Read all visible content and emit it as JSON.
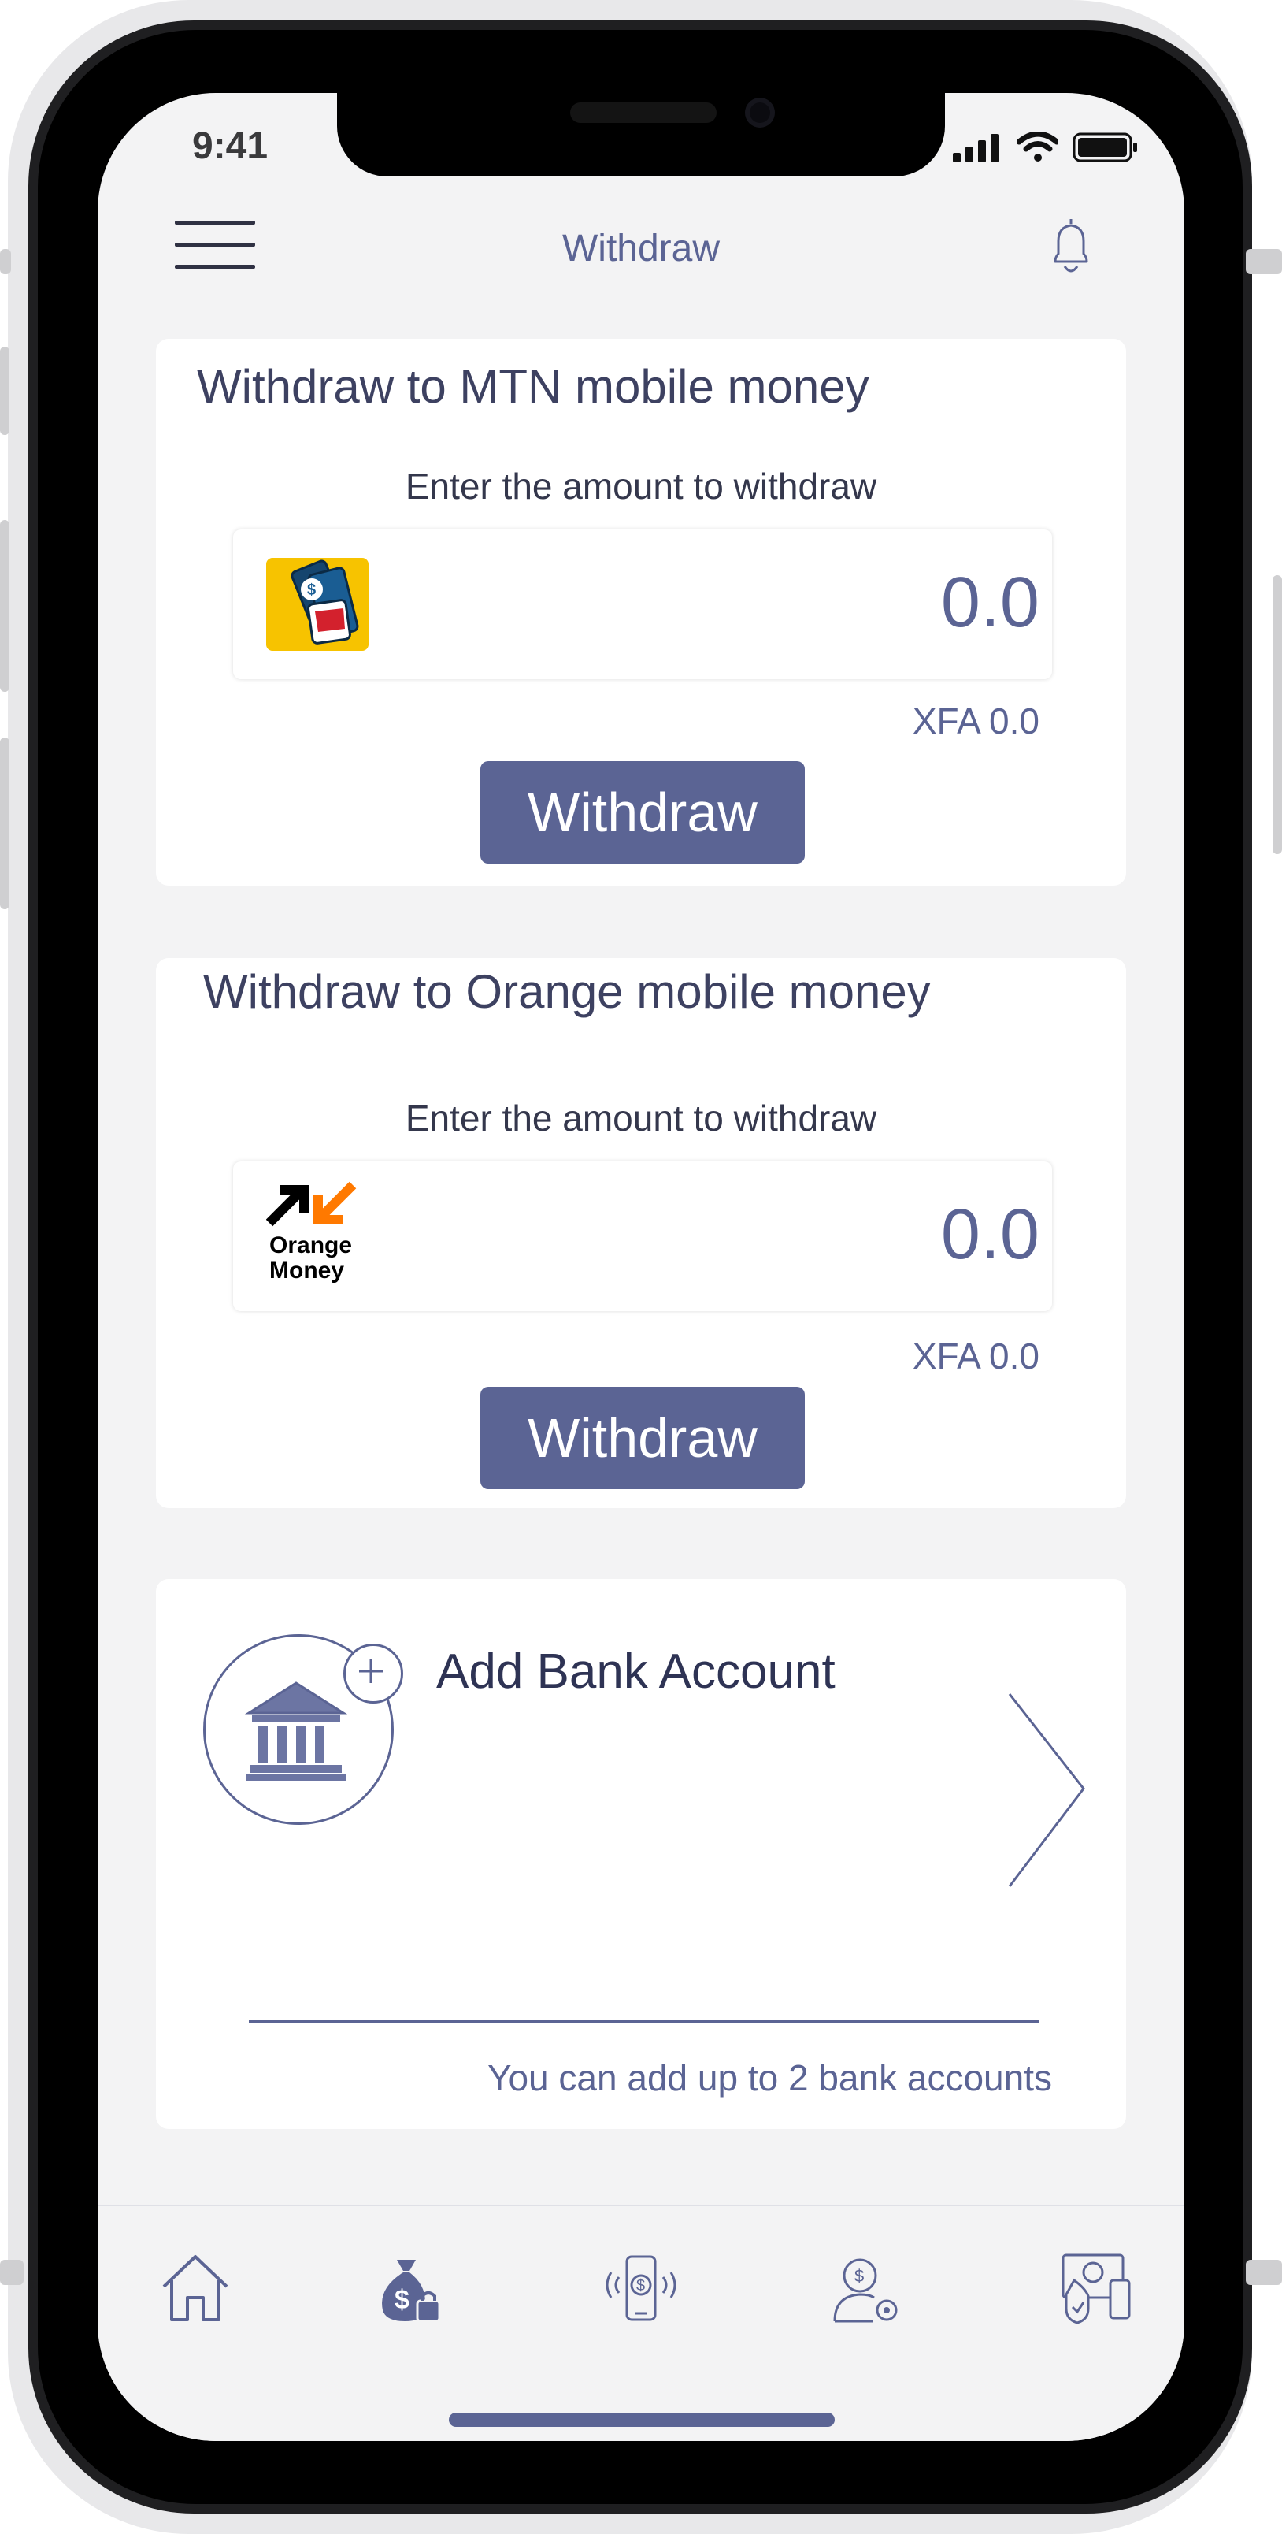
{
  "status_bar": {
    "time": "9:41"
  },
  "header": {
    "title": "Withdraw"
  },
  "mtn_card": {
    "title": "Withdraw to MTN mobile money",
    "prompt": "Enter the amount to withdraw",
    "amount": "0.0",
    "converted": "XFA 0.0",
    "button_label": "Withdraw"
  },
  "orange_card": {
    "title": "Withdraw to Orange mobile money",
    "prompt": "Enter the amount to withdraw",
    "amount": "0.0",
    "converted": "XFA 0.0",
    "button_label": "Withdraw",
    "logo_text_line1": "Orange",
    "logo_text_line2": "Money"
  },
  "bank_card": {
    "title": "Add Bank Account",
    "hint": "You can add up to 2 bank accounts"
  },
  "tabbar": {
    "items": [
      "home-icon",
      "money-bag-icon",
      "mobile-payment-icon",
      "user-settings-icon",
      "secure-payment-icon"
    ]
  },
  "colors": {
    "accent": "#5b6494",
    "mtn_yellow": "#f7c300",
    "orange": "#ff7900",
    "background": "#f3f3f4"
  }
}
